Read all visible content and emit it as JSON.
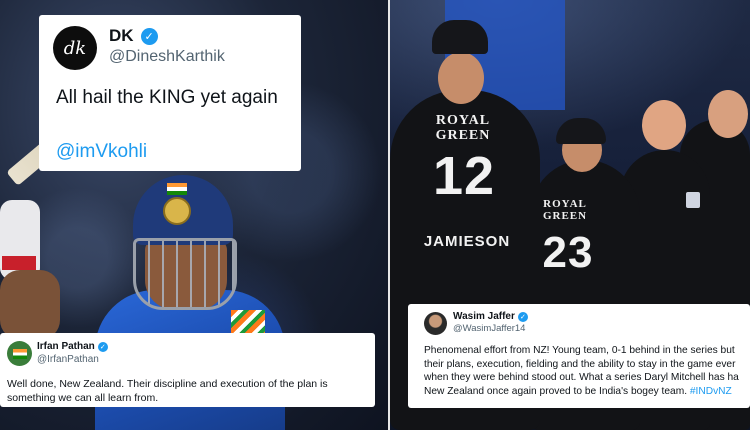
{
  "tweets": {
    "dk": {
      "avatar_text": "dk",
      "display_name": "DK",
      "handle": "@DineshKarthik",
      "text": "All hail the KING yet again",
      "mention": "@imVkohli"
    },
    "irfan": {
      "display_name": "Irfan Pathan",
      "handle": "@IrfanPathan",
      "text": "Well done, New Zealand. Their discipline and execution of the plan is something we can all learn from."
    },
    "wasim": {
      "display_name": "Wasim Jaffer",
      "handle": "@WasimJaffer14",
      "lines": [
        "Phenomenal effort from NZ! Young team, 0-1 behind in the series but",
        "their plans, execution, fielding and the ability to stay in the game ever",
        "when they were behind stood out. What a series Daryl Mitchell has ha",
        "New Zealand once again proved to be India's bogey team. "
      ],
      "hashtag": "#INDvNZ"
    }
  },
  "photo_right": {
    "sponsor_1": "ROYAL GREEN",
    "number_1": "12",
    "player_name_1": "JAMIESON",
    "sponsor_2": "ROYAL GREEN",
    "number_2": "23"
  },
  "colors": {
    "verified_blue": "#1d9bf0",
    "india_jersey": "#2a68d8",
    "nz_jersey": "#121316"
  },
  "icons": {
    "verified": "verified-badge-icon",
    "india_flag": "india-flag-icon"
  }
}
